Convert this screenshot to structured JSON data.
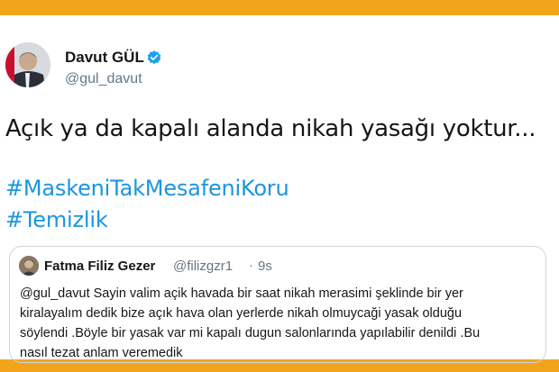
{
  "colors": {
    "frame": "#f2a51a",
    "card": "#ffffff",
    "link": "#1b95e0",
    "muted": "#657786",
    "verified": "#1da1f2"
  },
  "author": {
    "display_name": "Davut GÜL",
    "handle": "@gul_davut",
    "verified": true,
    "avatar_icon": "profile-photo"
  },
  "tweet": {
    "text": "Açık ya da kapalı alanda nikah yasağı yoktur...",
    "hashtags": [
      "#MaskeniTakMesafeniKoru",
      "#Temizlik"
    ]
  },
  "quoted": {
    "display_name": "Fatma Filiz Gezer",
    "handle": "@filizgzr1",
    "separator": "·",
    "time": "9s",
    "lines": [
      "@gul_davut Sayin valim açik havada bir saat nikah merasimi şeklinde bir yer",
      "kiralayalım dedik bize açık hava olan yerlerde nikah olmuycaği yasak olduğu",
      "söylendi .Böyle bir yasak var mi kapalı dugun salonlarında yapılabilir denildi .Bu",
      "nasıl tezat anlam veremedik"
    ]
  }
}
